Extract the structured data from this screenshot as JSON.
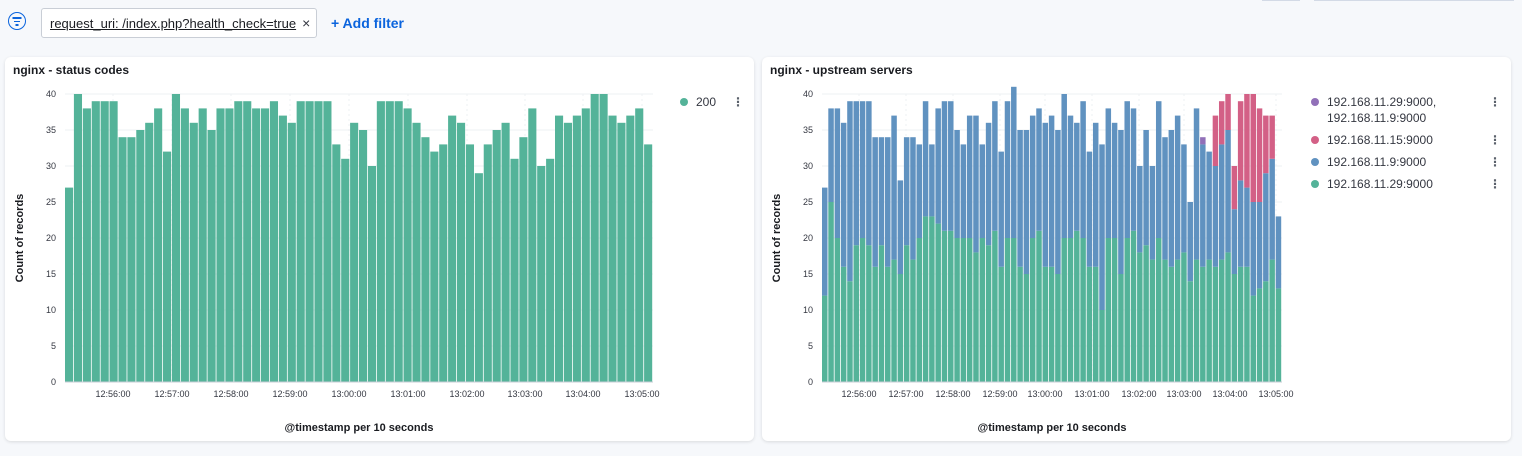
{
  "filterbar": {
    "filter_label": "request_uri: /index.php?health_check=true",
    "remove_label": "×",
    "add_filter_label": "+ Add filter"
  },
  "chart_data": [
    {
      "type": "bar",
      "title": "nginx - status codes",
      "xlabel": "@timestamp per 10 seconds",
      "ylabel": "Count of records",
      "ylim": [
        0,
        40
      ],
      "yticks": [
        0,
        5,
        10,
        15,
        20,
        25,
        30,
        35,
        40
      ],
      "xticks": [
        "12:56:00",
        "12:57:00",
        "12:58:00",
        "12:59:00",
        "13:00:00",
        "13:01:00",
        "13:02:00",
        "13:03:00",
        "13:04:00",
        "13:05:00"
      ],
      "grid": true,
      "legend_position": "right",
      "series": [
        {
          "name": "200",
          "color": "#54b399",
          "values": [
            27,
            40,
            38,
            39,
            39,
            39,
            34,
            34,
            35,
            36,
            38,
            32,
            40,
            38,
            36,
            38,
            35,
            38,
            38,
            39,
            39,
            38,
            38,
            39,
            37,
            36,
            39,
            39,
            39,
            39,
            33,
            31,
            36,
            35,
            30,
            39,
            39,
            39,
            38,
            36,
            34,
            32,
            33,
            37,
            36,
            33,
            29,
            33,
            35,
            36,
            31,
            34,
            38,
            30,
            31,
            37,
            36,
            37,
            38,
            40,
            40,
            37,
            36,
            37,
            38,
            33
          ]
        }
      ]
    },
    {
      "type": "bar",
      "stacked": true,
      "title": "nginx - upstream servers",
      "xlabel": "@timestamp per 10 seconds",
      "ylabel": "Count of records",
      "ylim": [
        0,
        40
      ],
      "yticks": [
        0,
        5,
        10,
        15,
        20,
        25,
        30,
        35,
        40
      ],
      "xticks": [
        "12:56:00",
        "12:57:00",
        "12:58:00",
        "12:59:00",
        "13:00:00",
        "13:01:00",
        "13:02:00",
        "13:03:00",
        "13:04:00",
        "13:05:00"
      ],
      "grid": true,
      "legend_position": "right",
      "series": [
        {
          "name": "192.168.11.29:9000",
          "color": "#54b399",
          "values": [
            12,
            25,
            20,
            16,
            14,
            19,
            20,
            19,
            16,
            19,
            16,
            17,
            15,
            19,
            17,
            20,
            23,
            23,
            22,
            21,
            21,
            20,
            20,
            20,
            18,
            20,
            19,
            21,
            16,
            20,
            20,
            16,
            15,
            20,
            21,
            16,
            16,
            15,
            20,
            20,
            21,
            20,
            16,
            16,
            10,
            20,
            20,
            15,
            20,
            21,
            18,
            19,
            17,
            20,
            17,
            16,
            17,
            18,
            14,
            17,
            16,
            17,
            16,
            17,
            18,
            15,
            16,
            16,
            12,
            13,
            14,
            17,
            13
          ]
        },
        {
          "name": "192.168.11.9:9000",
          "color": "#6092c0",
          "values": [
            15,
            13,
            18,
            20,
            25,
            20,
            19,
            20,
            18,
            15,
            18,
            20,
            13,
            15,
            17,
            13,
            16,
            10,
            16,
            18,
            18,
            15,
            13,
            17,
            19,
            13,
            17,
            18,
            16,
            19,
            21,
            19,
            20,
            17,
            17,
            20,
            21,
            20,
            20,
            17,
            15,
            19,
            16,
            20,
            23,
            18,
            16,
            20,
            19,
            17,
            12,
            16,
            13,
            19,
            17,
            19,
            20,
            15,
            11,
            21,
            17,
            15,
            14,
            16,
            17,
            9,
            12,
            11,
            13,
            12,
            15,
            14,
            10
          ]
        },
        {
          "name": "192.168.11.15:9000",
          "color": "#d36086",
          "values": [
            0,
            0,
            0,
            0,
            0,
            0,
            0,
            0,
            0,
            0,
            0,
            0,
            0,
            0,
            0,
            0,
            0,
            0,
            0,
            0,
            0,
            0,
            0,
            0,
            0,
            0,
            0,
            0,
            0,
            0,
            0,
            0,
            0,
            0,
            0,
            0,
            0,
            0,
            0,
            0,
            0,
            0,
            0,
            0,
            0,
            0,
            0,
            0,
            0,
            0,
            0,
            0,
            0,
            0,
            0,
            0,
            0,
            0,
            0,
            0,
            0,
            0,
            7,
            6,
            5,
            6,
            11,
            13,
            15,
            13,
            8,
            6,
            0
          ]
        },
        {
          "name": "192.168.11.29:9000, 192.168.11.9:9000",
          "color": "#9170b8",
          "values": [
            0,
            0,
            0,
            0,
            0,
            0,
            0,
            0,
            0,
            0,
            0,
            0,
            0,
            0,
            0,
            0,
            0,
            0,
            0,
            0,
            0,
            0,
            0,
            0,
            0,
            0,
            0,
            0,
            0,
            0,
            0,
            0,
            0,
            0,
            0,
            0,
            0,
            0,
            0,
            0,
            0,
            0,
            0,
            0,
            0,
            0,
            0,
            0,
            0,
            0,
            0,
            0,
            0,
            0,
            0,
            0,
            0,
            0,
            0,
            0,
            1,
            0,
            0,
            0,
            0,
            0,
            0,
            0,
            0,
            0,
            0,
            0,
            0
          ]
        }
      ]
    }
  ]
}
